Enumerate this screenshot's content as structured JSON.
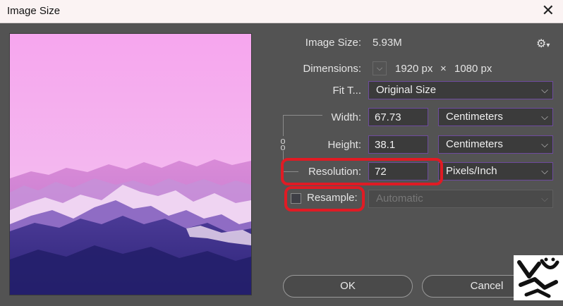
{
  "window": {
    "title": "Image Size",
    "close_glyph": "✕"
  },
  "info": {
    "image_size_label": "Image Size:",
    "image_size_value": "5.93M",
    "dimensions_label": "Dimensions:",
    "dimensions_width": "1920 px",
    "dimensions_sep": "×",
    "dimensions_height": "1080 px"
  },
  "fit": {
    "label": "Fit T...",
    "selected": "Original Size"
  },
  "width": {
    "label": "Width:",
    "value": "67.73",
    "unit": "Centimeters"
  },
  "height": {
    "label": "Height:",
    "value": "38.1",
    "unit": "Centimeters"
  },
  "resolution": {
    "label": "Resolution:",
    "value": "72",
    "unit": "Pixels/Inch"
  },
  "resample": {
    "label": "Resample:",
    "checked": false,
    "method": "Automatic"
  },
  "buttons": {
    "ok": "OK",
    "cancel": "Cancel"
  },
  "icons": {
    "settings": "gear-icon",
    "link": "chain-link-icon",
    "dropdown": "chevron-down-icon"
  },
  "colors": {
    "field_border": "#6e4a9e",
    "highlight": "#e01b24",
    "panel": "#535353"
  }
}
